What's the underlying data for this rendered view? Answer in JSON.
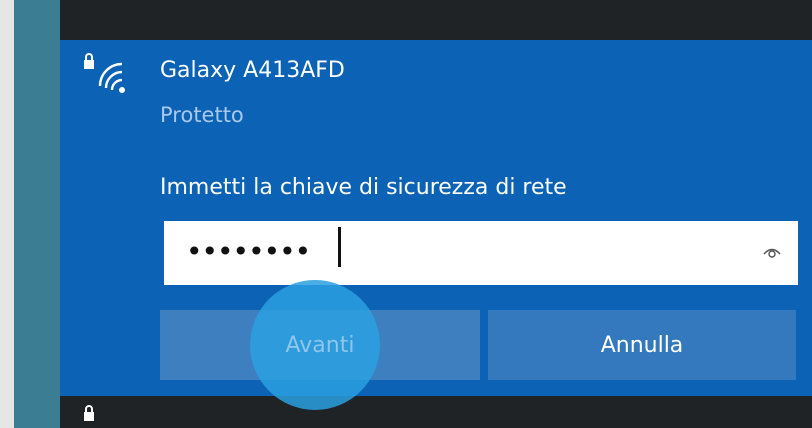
{
  "network": {
    "name": "Galaxy A413AFD",
    "status": "Protetto",
    "icon": "wifi-secured-icon"
  },
  "security_key": {
    "label": "Immetti la chiave di sicurezza di rete",
    "masked_value": "••••••••",
    "reveal_icon": "eye-icon"
  },
  "buttons": {
    "next_label": "Avanti",
    "cancel_label": "Annulla"
  },
  "colors": {
    "card_blue": "#0c62b4",
    "button_blue": "#3478be",
    "tap_highlight": "#2aa0e1",
    "panel_dark": "#1f2326"
  }
}
